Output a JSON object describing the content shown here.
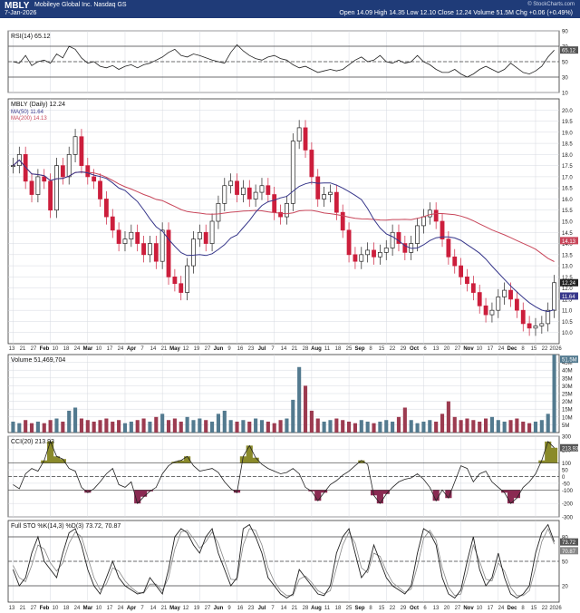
{
  "header": {
    "symbol": "MBLY",
    "name": "Mobileye Global Inc.  Nasdaq GS",
    "date": "7-Jan-2026",
    "quote": "Open 14.09  High 14.35  Low 12.10  Close 12.24  Volume 51.5M  Chg +0.06 (+0.49%)",
    "copyright": "© StockCharts.com"
  },
  "colors": {
    "up": "#222222",
    "down": "#cc1e3c",
    "ma50": "#36368a",
    "ma200": "#c8465a",
    "volume": "#537a8f",
    "volume_down": "#9c3b50",
    "cci_pos": "#8a8a2a",
    "cci_neg": "#8a2a52",
    "grid": "#d6d9e0",
    "frame": "#333333"
  },
  "chart_data": [
    {
      "type": "line",
      "panel": "rsi",
      "label": "RSI(14) 65.12",
      "ylim": [
        10,
        90
      ],
      "ticks": [
        10,
        30,
        50,
        70,
        90
      ],
      "reference_lines": [
        30,
        50,
        70
      ],
      "last_value": "65.12",
      "values": [
        50,
        48,
        58,
        45,
        50,
        52,
        48,
        60,
        55,
        70,
        66,
        55,
        48,
        50,
        44,
        42,
        45,
        40,
        44,
        46,
        42,
        46,
        48,
        52,
        56,
        62,
        66,
        58,
        56,
        60,
        58,
        55,
        52,
        50,
        48,
        62,
        72,
        64,
        58,
        54,
        52,
        56,
        58,
        54,
        52,
        46,
        42,
        44,
        40,
        36,
        38,
        40,
        38,
        40,
        46,
        52,
        56,
        50,
        52,
        58,
        50,
        48,
        52,
        48,
        50,
        58,
        50,
        46,
        40,
        36,
        36,
        40,
        34,
        30,
        34,
        40,
        44,
        40,
        36,
        40,
        48,
        42,
        36,
        34,
        38,
        44,
        56,
        65
      ]
    },
    {
      "type": "candlestick",
      "panel": "price",
      "label": "MBLY (Daily) 12.24",
      "ylim": [
        9.5,
        20.5
      ],
      "ticks": [
        10,
        10.5,
        11,
        11.5,
        12,
        12.5,
        13,
        13.5,
        14,
        14.5,
        15,
        15.5,
        16,
        16.5,
        17,
        17.5,
        18,
        18.5,
        19,
        19.5,
        20
      ],
      "legend": [
        "MA(50) 11.64",
        "MA(200) 14.13"
      ],
      "last_labels": [
        "14.13",
        "12.24",
        "11.64"
      ],
      "x_labels": [
        "13",
        "21",
        "27",
        "Feb",
        "10",
        "18",
        "24",
        "Mar",
        "10",
        "17",
        "24",
        "Apr",
        "7",
        "14",
        "21",
        "May",
        "12",
        "19",
        "27",
        "Jun",
        "9",
        "16",
        "23",
        "Jul",
        "7",
        "14",
        "21",
        "28",
        "Aug",
        "11",
        "18",
        "25",
        "Sep",
        "8",
        "15",
        "22",
        "29",
        "Oct",
        "6",
        "13",
        "20",
        "27",
        "Nov",
        "10",
        "17",
        "24",
        "Dec",
        "8",
        "15",
        "22",
        "2026"
      ],
      "close": [
        17.5,
        18.0,
        16.8,
        16.2,
        17.0,
        16.8,
        15.5,
        17.5,
        17.0,
        18.0,
        18.8,
        17.5,
        17.0,
        16.8,
        16.0,
        15.2,
        14.6,
        14.0,
        14.2,
        14.5,
        14.0,
        13.5,
        14.0,
        13.2,
        14.6,
        12.5,
        12.2,
        11.8,
        13.0,
        14.2,
        14.5,
        14.0,
        15.0,
        15.8,
        16.6,
        16.8,
        16.2,
        16.5,
        16.0,
        16.3,
        16.6,
        16.2,
        15.4,
        15.2,
        15.8,
        18.6,
        19.2,
        18.2,
        17.0,
        16.0,
        16.2,
        16.3,
        15.4,
        14.6,
        13.5,
        13.2,
        13.5,
        13.7,
        13.4,
        13.6,
        13.8,
        14.5,
        14.0,
        13.6,
        14.0,
        14.8,
        15.2,
        15.5,
        15.0,
        14.2,
        13.4,
        13.0,
        12.5,
        12.2,
        11.8,
        11.2,
        10.8,
        11.0,
        11.6,
        11.9,
        11.5,
        11.0,
        10.4,
        10.2,
        10.3,
        10.4,
        11.0,
        12.24
      ]
    },
    {
      "type": "bar",
      "panel": "volume",
      "label": "Volume 51,469,704",
      "ylim": [
        0,
        50
      ],
      "ticks": [
        5,
        10,
        15,
        20,
        25,
        30,
        35,
        40,
        45
      ],
      "unit_suffix": "M",
      "last_value": "51.5M",
      "values": [
        7,
        6,
        8,
        6,
        7,
        6,
        8,
        9,
        7,
        14,
        16,
        9,
        8,
        7,
        8,
        9,
        7,
        8,
        6,
        7,
        8,
        9,
        7,
        10,
        12,
        8,
        9,
        7,
        10,
        8,
        9,
        8,
        7,
        12,
        14,
        8,
        7,
        8,
        7,
        9,
        8,
        7,
        6,
        8,
        9,
        21,
        42,
        30,
        14,
        9,
        7,
        8,
        9,
        8,
        7,
        6,
        8,
        7,
        6,
        7,
        8,
        7,
        10,
        16,
        8,
        6,
        7,
        8,
        7,
        12,
        20,
        10,
        8,
        9,
        8,
        7,
        9,
        10,
        8,
        7,
        8,
        9,
        7,
        6,
        7,
        8,
        12,
        51.5
      ]
    },
    {
      "type": "area",
      "panel": "cci",
      "label": "CCI(20) 213.93",
      "ylim": [
        -300,
        300
      ],
      "ticks": [
        -300,
        -200,
        -100,
        -50,
        0,
        50,
        100,
        200,
        300
      ],
      "reference_lines": [
        -100,
        0,
        100
      ],
      "last_value": "213.93",
      "values": [
        -60,
        -90,
        20,
        60,
        40,
        120,
        260,
        150,
        130,
        60,
        40,
        -80,
        -120,
        -90,
        -40,
        20,
        60,
        -60,
        -80,
        -40,
        -200,
        -150,
        -110,
        -80,
        20,
        80,
        110,
        120,
        150,
        80,
        40,
        50,
        60,
        30,
        -40,
        -90,
        -120,
        150,
        230,
        140,
        90,
        60,
        40,
        20,
        30,
        60,
        20,
        -80,
        -110,
        -180,
        -120,
        -60,
        -30,
        10,
        40,
        80,
        120,
        90,
        -140,
        -200,
        -130,
        -80,
        -40,
        -20,
        -10,
        20,
        -20,
        -80,
        -180,
        -100,
        -160,
        -40,
        80,
        60,
        -40,
        20,
        40,
        -40,
        -80,
        -120,
        -200,
        -160,
        -80,
        -40,
        20,
        120,
        260,
        214
      ]
    },
    {
      "type": "line",
      "panel": "stochastic",
      "label": "Full STO %K(14,3) %D(3) 73.72, 70.87",
      "ylim": [
        0,
        100
      ],
      "ticks": [
        20,
        50,
        80
      ],
      "reference_lines": [
        20,
        50,
        80
      ],
      "last_labels": [
        "73.72",
        "70.87"
      ],
      "series": [
        {
          "name": "%K",
          "values": [
            40,
            20,
            30,
            60,
            80,
            50,
            40,
            30,
            60,
            85,
            90,
            70,
            40,
            20,
            10,
            30,
            50,
            30,
            20,
            15,
            10,
            12,
            30,
            20,
            10,
            40,
            80,
            90,
            85,
            70,
            60,
            80,
            90,
            60,
            40,
            20,
            30,
            90,
            95,
            80,
            60,
            30,
            20,
            10,
            5,
            10,
            40,
            30,
            20,
            10,
            8,
            20,
            60,
            80,
            90,
            60,
            30,
            40,
            70,
            50,
            30,
            20,
            15,
            10,
            20,
            60,
            90,
            85,
            70,
            30,
            10,
            5,
            15,
            50,
            80,
            40,
            20,
            30,
            60,
            30,
            10,
            5,
            10,
            20,
            60,
            85,
            95,
            74
          ]
        },
        {
          "name": "%D",
          "values": [
            45,
            30,
            25,
            45,
            70,
            65,
            48,
            38,
            48,
            72,
            86,
            80,
            55,
            30,
            15,
            22,
            42,
            38,
            26,
            18,
            12,
            11,
            22,
            22,
            14,
            30,
            65,
            86,
            88,
            78,
            66,
            74,
            86,
            72,
            50,
            28,
            27,
            70,
            90,
            88,
            70,
            42,
            25,
            14,
            8,
            8,
            28,
            32,
            24,
            14,
            10,
            14,
            42,
            70,
            86,
            72,
            42,
            36,
            60,
            56,
            38,
            24,
            18,
            12,
            16,
            44,
            78,
            88,
            76,
            42,
            18,
            8,
            10,
            36,
            70,
            50,
            28,
            26,
            48,
            38,
            18,
            8,
            8,
            14,
            42,
            74,
            90,
            71
          ]
        }
      ]
    }
  ]
}
